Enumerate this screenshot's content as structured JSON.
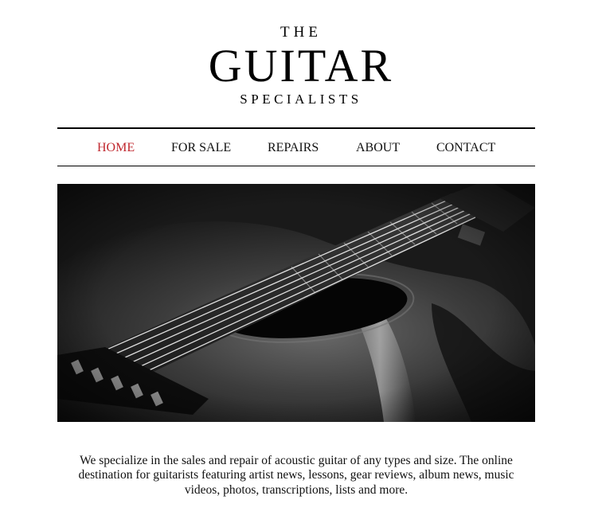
{
  "logo": {
    "line1": "THE",
    "line2": "GUITAR",
    "line3": "SPECIALISTS"
  },
  "nav": {
    "items": [
      {
        "label": "HOME",
        "active": true
      },
      {
        "label": "FOR SALE",
        "active": false
      },
      {
        "label": "REPAIRS",
        "active": false
      },
      {
        "label": "ABOUT",
        "active": false
      },
      {
        "label": "CONTACT",
        "active": false
      }
    ],
    "active_color": "#c0282f"
  },
  "hero": {
    "subject": "black-and-white acoustic guitar close-up"
  },
  "intro": {
    "text": "We specialize in the sales and repair of acoustic guitar of any types and size. The online destination for guitarists featuring artist news, lessons, gear reviews, album news, music videos, photos, transcriptions, lists and more."
  }
}
